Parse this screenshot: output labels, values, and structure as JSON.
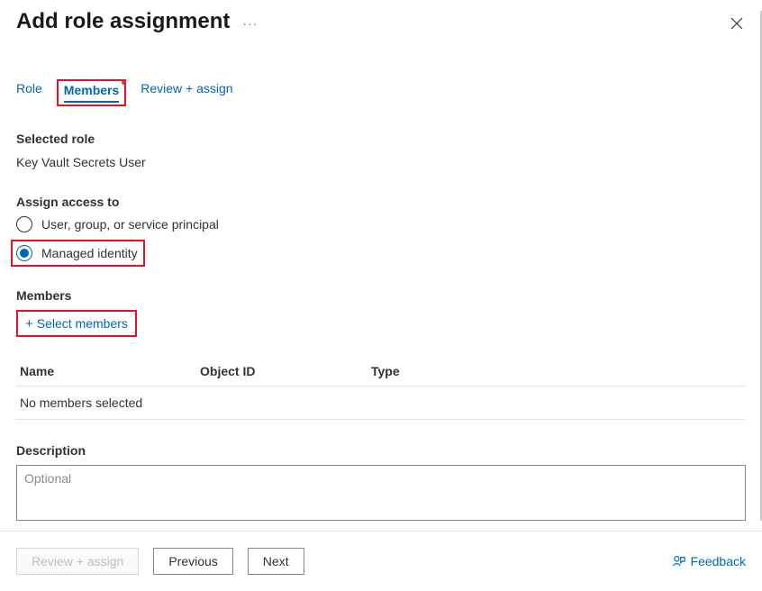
{
  "header": {
    "title": "Add role assignment"
  },
  "tabs": {
    "role": "Role",
    "members": "Members",
    "review": "Review + assign"
  },
  "selected_role": {
    "label": "Selected role",
    "value": "Key Vault Secrets User"
  },
  "assign_access": {
    "label": "Assign access to",
    "option_user": "User, group, or service principal",
    "option_managed": "Managed identity"
  },
  "members": {
    "label": "Members",
    "select_link": "Select members"
  },
  "table": {
    "col_name": "Name",
    "col_object_id": "Object ID",
    "col_type": "Type",
    "empty": "No members selected"
  },
  "description": {
    "label": "Description",
    "placeholder": "Optional"
  },
  "footer": {
    "review": "Review + assign",
    "previous": "Previous",
    "next": "Next",
    "feedback": "Feedback"
  }
}
